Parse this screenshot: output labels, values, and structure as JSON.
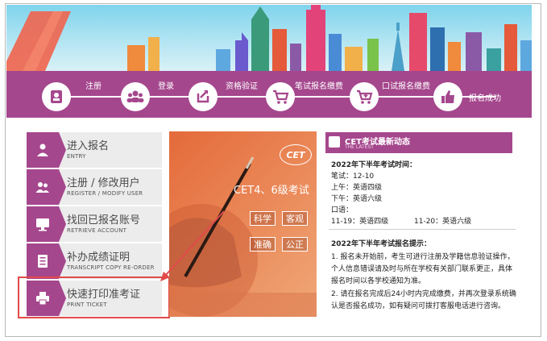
{
  "steps": [
    {
      "label": "注册",
      "icon": "user-card-icon"
    },
    {
      "label": "登录",
      "icon": "users-icon"
    },
    {
      "label": "资格验证",
      "icon": "refresh-icon"
    },
    {
      "label": "笔试报名缴费",
      "icon": "cart-icon"
    },
    {
      "label": "口试报名缴费",
      "icon": "cart-plus-icon"
    },
    {
      "label": "报名成功",
      "icon": "thumbs-up-icon"
    }
  ],
  "menu": [
    {
      "zh": "进入报名",
      "en": "ENTRY",
      "icon": "person-icon"
    },
    {
      "zh": "注册 / 修改用户",
      "en": "REGISTER / MODIFY USER",
      "icon": "users-icon"
    },
    {
      "zh": "找回已报名账号",
      "en": "RETRIEVE ACCOUNT",
      "icon": "monitor-icon"
    },
    {
      "zh": "补办成绩证明",
      "en": "TRANSCRIPT COPY RE-ORDER",
      "icon": "list-icon"
    },
    {
      "zh": "快速打印准考证",
      "en": "PRINT TICKET",
      "icon": "printer-icon"
    }
  ],
  "poster": {
    "logo": "CET",
    "title": "CET4、6级考试",
    "tags": [
      "科学",
      "客观",
      "准确",
      "公正"
    ]
  },
  "news": {
    "title": "CET考试最新动态",
    "subtitle": "THE LATEST",
    "section1_title": "2022年下半年考试时间：",
    "written_label": "笔试：12-10",
    "am": "上午：英语四级",
    "pm": "下午：英语六级",
    "oral_label": "口语：",
    "oral_1": "11-19：英语四级",
    "oral_2": "11-20：英语六级",
    "section2_title": "2022年下半年考试报名提示：",
    "tip1_l1": "1. 报名未开始前，考生可进行注册及学籍信息验证操作，",
    "tip1_l2": "个人信息错误请及时与所在学校有关部门联系更正，具体",
    "tip1_l3": "报名时间以各学校通知为准。",
    "tip2_l1": "2. 请在报名完成后24小时内完成缴费，并再次登录系统确",
    "tip2_l2": "认是否报名成功，如有疑问可拨打客服电话进行咨询。"
  },
  "colors": {
    "brand": "#a5478d",
    "menu_bg": "#ececec",
    "highlight": "#e24a4a",
    "poster": "#e46a3a"
  }
}
